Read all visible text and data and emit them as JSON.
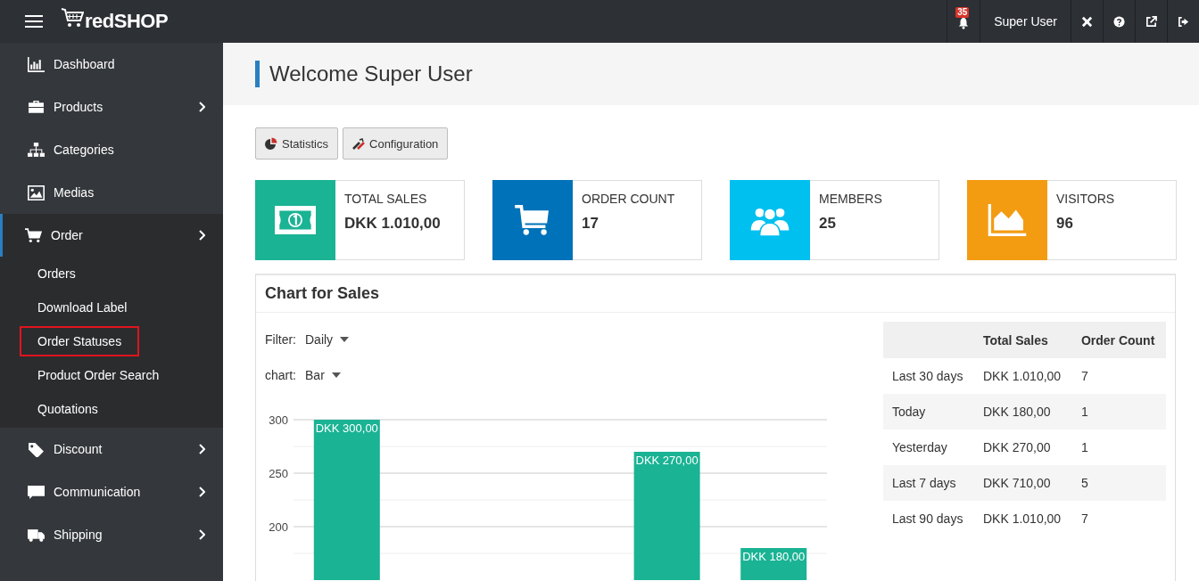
{
  "topbar": {
    "brand": "redSHOP",
    "notifications": "35",
    "user": "Super User"
  },
  "sidebar": {
    "items": [
      {
        "label": "Dashboard",
        "has_children": false,
        "selected": false
      },
      {
        "label": "Products",
        "has_children": true,
        "selected": false
      },
      {
        "label": "Categories",
        "has_children": false,
        "selected": false
      },
      {
        "label": "Medias",
        "has_children": false,
        "selected": false
      },
      {
        "label": "Order",
        "has_children": true,
        "selected": true,
        "children": [
          {
            "label": "Orders",
            "highlighted": false
          },
          {
            "label": "Download Label",
            "highlighted": false
          },
          {
            "label": "Order Statuses",
            "highlighted": true
          },
          {
            "label": "Product Order Search",
            "highlighted": false
          },
          {
            "label": "Quotations",
            "highlighted": false
          }
        ]
      },
      {
        "label": "Discount",
        "has_children": true,
        "selected": false
      },
      {
        "label": "Communication",
        "has_children": true,
        "selected": false
      },
      {
        "label": "Shipping",
        "has_children": true,
        "selected": false
      }
    ]
  },
  "page_title": "Welcome Super User",
  "toolbar": [
    {
      "label": "Statistics"
    },
    {
      "label": "Configuration"
    }
  ],
  "stats": [
    {
      "label": "TOTAL SALES",
      "value": "DKK 1.010,00",
      "color": "#1ab394"
    },
    {
      "label": "ORDER COUNT",
      "value": "17",
      "color": "#0072b9"
    },
    {
      "label": "MEMBERS",
      "value": "25",
      "color": "#00c0ef"
    },
    {
      "label": "VISITORS",
      "value": "96",
      "color": "#f39c12"
    }
  ],
  "chart_panel": {
    "title": "Chart for Sales",
    "filter_label": "Filter:",
    "filter_value": "Daily",
    "chart_label": "chart:",
    "chart_value": "Bar",
    "chart_data": {
      "type": "bar",
      "series": [
        {
          "color": "#1ab394",
          "values": [
            300,
            null,
            null,
            270,
            180
          ]
        }
      ],
      "ylim": [
        150,
        300
      ],
      "yticks": [
        200,
        250,
        300
      ],
      "value_labels": [
        "DKK 300,00",
        null,
        null,
        "DKK 270,00",
        "DKK 180,00"
      ]
    }
  },
  "summary_table": {
    "columns": [
      "",
      "Total Sales",
      "Order Count"
    ],
    "rows": [
      [
        "Last 30 days",
        "DKK 1.010,00",
        "7"
      ],
      [
        "Today",
        "DKK 180,00",
        "1"
      ],
      [
        "Yesterday",
        "DKK 270,00",
        "1"
      ],
      [
        "Last 7 days",
        "DKK 710,00",
        "5"
      ],
      [
        "Last 90 days",
        "DKK 1.010,00",
        "7"
      ]
    ]
  }
}
